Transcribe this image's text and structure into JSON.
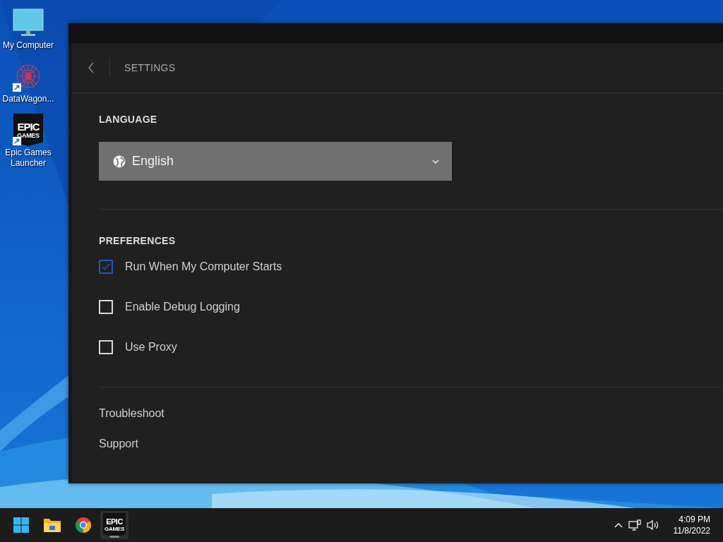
{
  "desktop": {
    "icons": [
      {
        "kind": "computer",
        "label": "My Computer",
        "shortcut": false
      },
      {
        "kind": "network",
        "label": "DataWagon...",
        "shortcut": true
      },
      {
        "kind": "epic",
        "label": "Epic Games Launcher",
        "shortcut": true,
        "logo": [
          "EPIC",
          "GAMES"
        ]
      }
    ]
  },
  "window": {
    "header": {
      "title": "SETTINGS"
    },
    "language": {
      "heading": "LANGUAGE",
      "value": "English"
    },
    "preferences": {
      "heading": "PREFERENCES",
      "options": [
        {
          "label": "Run When My Computer Starts",
          "checked": true
        },
        {
          "label": "Enable Debug Logging",
          "checked": false
        },
        {
          "label": "Use Proxy",
          "checked": false
        }
      ]
    },
    "links": [
      "Troubleshoot",
      "Support"
    ]
  },
  "taskbar": {
    "apps": [
      {
        "kind": "start",
        "selected": false
      },
      {
        "kind": "folder",
        "selected": false
      },
      {
        "kind": "browser",
        "selected": false
      },
      {
        "kind": "epic",
        "selected": true,
        "logo": [
          "EPIC",
          "GAMES"
        ]
      }
    ],
    "clock": {
      "time": "4:09 PM",
      "date": "11/8/2022"
    }
  }
}
